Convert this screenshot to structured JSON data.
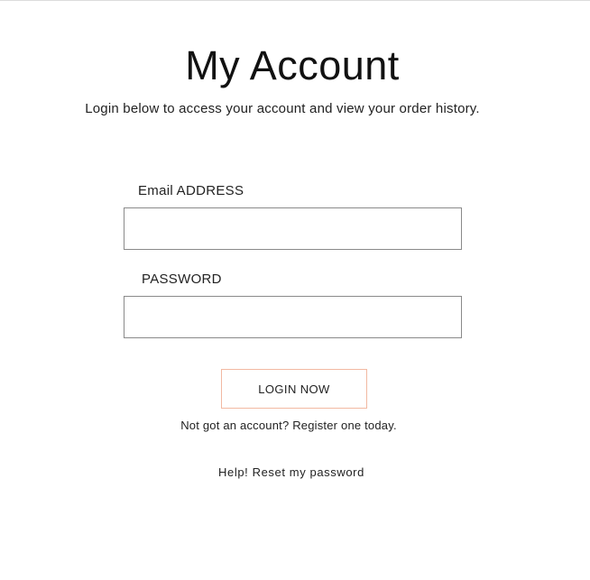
{
  "header": {
    "title": "My Account",
    "subtitle": "Login below to access your account and view your order history."
  },
  "form": {
    "email_label": "Email ADDRESS",
    "email_value": "",
    "email_placeholder": "",
    "password_label": "PASSWORD",
    "password_value": "",
    "password_placeholder": "",
    "login_button_label": "LOGIN NOW"
  },
  "links": {
    "register": "Not got an account? Register one today.",
    "reset_password": "Help! Reset my password"
  },
  "colors": {
    "button_border": "#f2b9a2",
    "field_border": "#8a8a8a",
    "text": "#222222"
  }
}
